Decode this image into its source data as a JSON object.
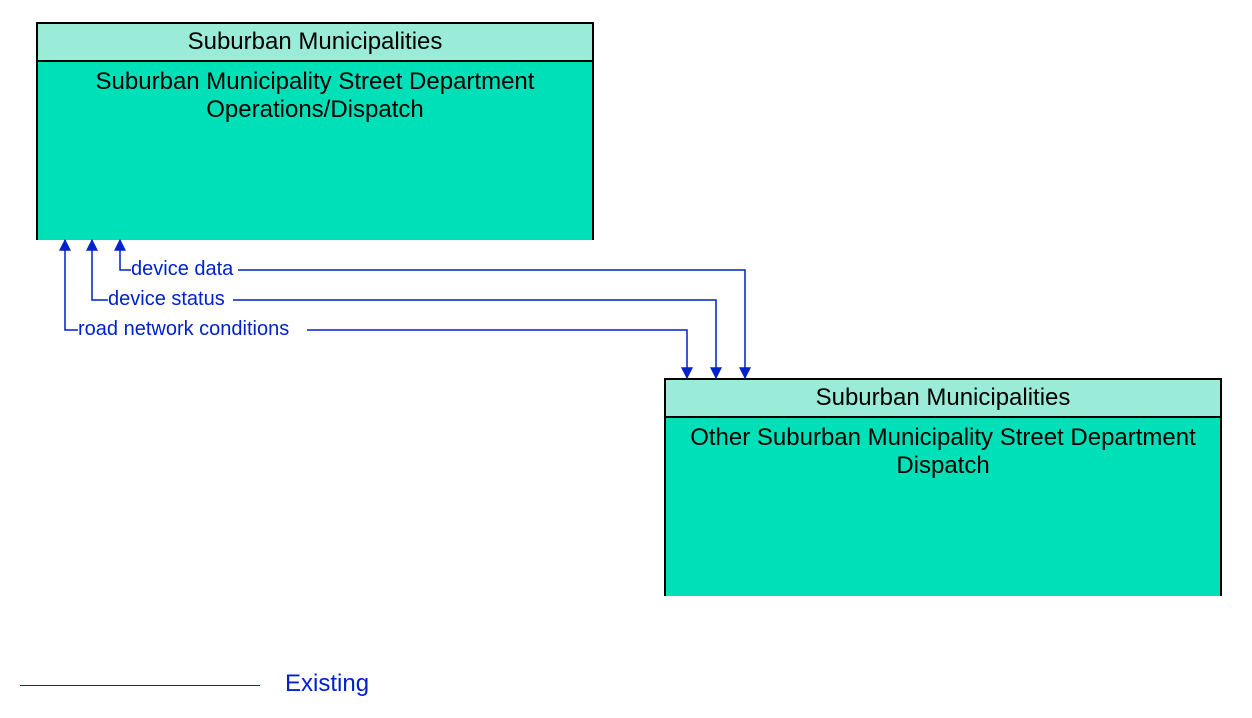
{
  "entities": {
    "top": {
      "header": "Suburban Municipalities",
      "body": "Suburban Municipality Street Department Operations/Dispatch"
    },
    "bottom": {
      "header": "Suburban Municipalities",
      "body": "Other Suburban Municipality Street Department Dispatch"
    }
  },
  "flows": {
    "device_data": "device data",
    "device_status": "device status",
    "road_network_conditions": "road network conditions"
  },
  "legend": {
    "existing": "Existing"
  },
  "colors": {
    "flow_line": "#0021cc",
    "box_header_bg": "#9BEBD9",
    "box_body_bg": "#00E0B8"
  }
}
